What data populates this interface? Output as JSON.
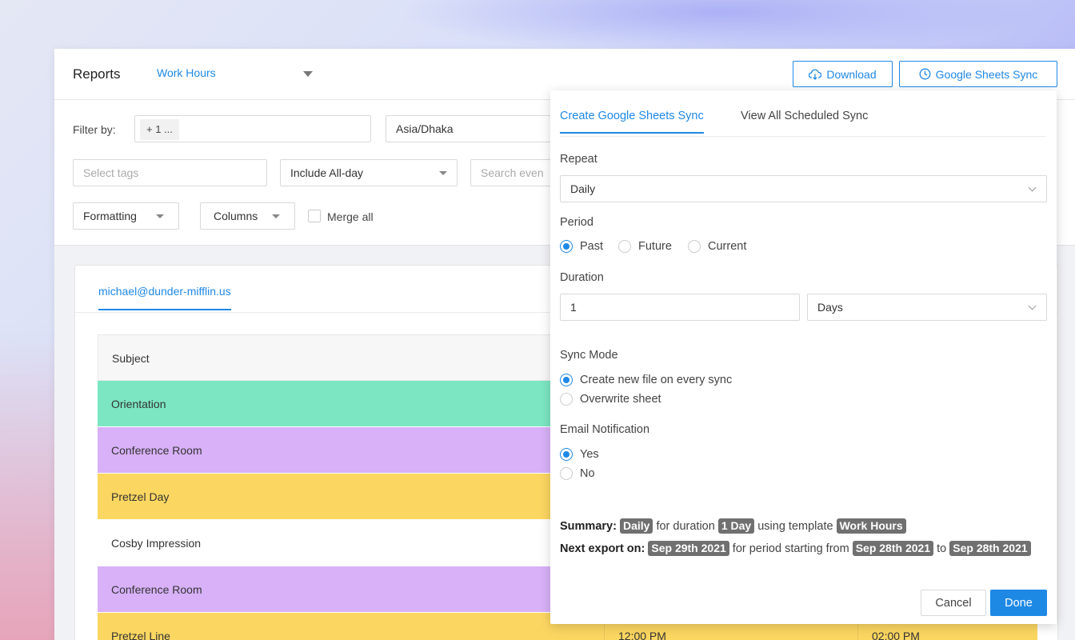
{
  "header": {
    "title": "Reports",
    "report_select": "Work Hours",
    "download_label": "Download",
    "gsync_label": "Google Sheets Sync"
  },
  "filters": {
    "label": "Filter by:",
    "calendar_chip": "+ 1 ...",
    "timezone": "Asia/Dhaka",
    "tags_placeholder": "Select tags",
    "allday_select": "Include All-day",
    "search_placeholder": "Search even",
    "formatting_label": "Formatting",
    "columns_label": "Columns",
    "merge_all_label": "Merge all"
  },
  "card": {
    "user_tab": "michael@dunder-mifflin.us",
    "table": {
      "header_subject": "Subject",
      "rows": [
        {
          "subject": "Orientation",
          "color": "#7ce6c2",
          "start": "",
          "end": ""
        },
        {
          "subject": "Conference Room",
          "color": "#d8b1f8",
          "start": "",
          "end": ""
        },
        {
          "subject": "Pretzel Day",
          "color": "#fbd661",
          "start": "",
          "end": ""
        },
        {
          "subject": "Cosby Impression",
          "color": "#ffffff",
          "start": "",
          "end": ""
        },
        {
          "subject": "Conference Room",
          "color": "#d8b1f8",
          "start": "",
          "end": ""
        },
        {
          "subject": "Pretzel Line",
          "color": "#fbd661",
          "start": "12:00 PM",
          "end": "02:00 PM"
        }
      ]
    }
  },
  "panel": {
    "tabs": [
      "Create Google Sheets Sync",
      "View All Scheduled Sync"
    ],
    "repeat": {
      "label": "Repeat",
      "value": "Daily"
    },
    "period": {
      "label": "Period",
      "options": [
        "Past",
        "Future",
        "Current"
      ],
      "selected": "Past"
    },
    "duration": {
      "label": "Duration",
      "value": "1",
      "unit": "Days"
    },
    "sync_mode": {
      "label": "Sync Mode",
      "options": [
        "Create new file on every sync",
        "Overwrite sheet"
      ],
      "selected": "Create new file on every sync"
    },
    "email": {
      "label": "Email Notification",
      "options": [
        "Yes",
        "No"
      ],
      "selected": "Yes"
    },
    "summary": {
      "summary_label": "Summary:",
      "repeat_tag": "Daily",
      "for_duration": "for duration",
      "duration_tag": "1 Day",
      "using_template": "using template",
      "template_tag": "Work Hours",
      "next_export_label": "Next export on:",
      "next_export_tag": "Sep 29th 2021",
      "period_starting": "for period starting from",
      "start_tag": "Sep 28th 2021",
      "to": "to",
      "end_tag": "Sep 28th 2021"
    },
    "cancel_label": "Cancel",
    "done_label": "Done"
  },
  "colors": {
    "accent": "#1e88e5",
    "tag_bg": "#707070"
  }
}
